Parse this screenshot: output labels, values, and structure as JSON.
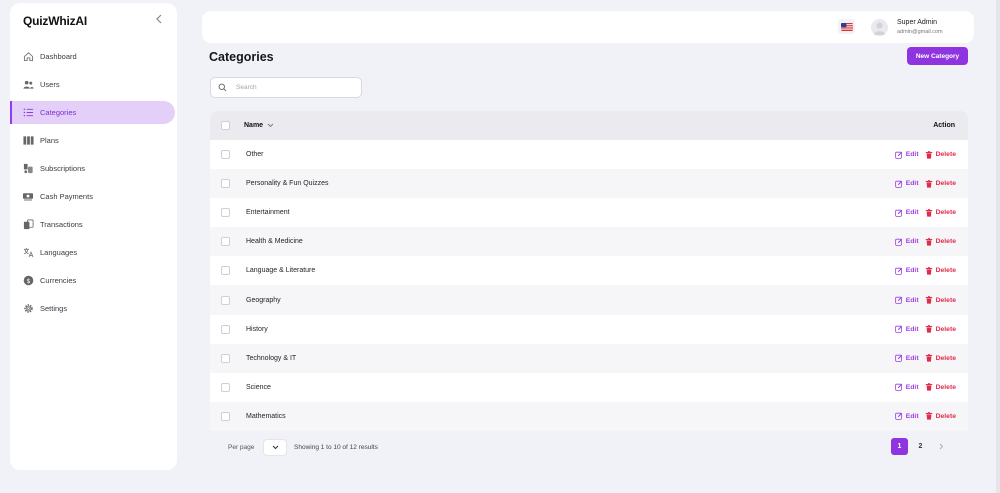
{
  "app": {
    "name": "QuizWhizAI"
  },
  "sidebar": {
    "items": [
      {
        "label": "Dashboard",
        "icon": "home-icon"
      },
      {
        "label": "Users",
        "icon": "users-icon"
      },
      {
        "label": "Categories",
        "icon": "list-icon",
        "active": true
      },
      {
        "label": "Plans",
        "icon": "columns-icon"
      },
      {
        "label": "Subscriptions",
        "icon": "subscriptions-icon"
      },
      {
        "label": "Cash Payments",
        "icon": "cash-icon"
      },
      {
        "label": "Transactions",
        "icon": "transactions-icon"
      },
      {
        "label": "Languages",
        "icon": "translate-icon"
      },
      {
        "label": "Currencies",
        "icon": "currency-icon"
      },
      {
        "label": "Settings",
        "icon": "gear-icon"
      }
    ]
  },
  "header": {
    "user_name": "Super Admin",
    "user_email": "admin@gmail.com",
    "language_flag": "us-flag-icon"
  },
  "page": {
    "title": "Categories",
    "new_button": "New Category",
    "search_placeholder": "Search"
  },
  "table": {
    "col_name": "Name",
    "col_action": "Action",
    "edit_label": "Edit",
    "delete_label": "Delete",
    "rows": [
      "Other",
      "Personality & Fun Quizzes",
      "Entertainment",
      "Health & Medicine",
      "Language & Literature",
      "Geography",
      "History",
      "Technology & IT",
      "Science",
      "Mathematics"
    ]
  },
  "footer": {
    "per_page_label": "Per page",
    "showing": "Showing 1 to 10 of 12 results",
    "pages": [
      "1",
      "2"
    ],
    "current_page": "1"
  },
  "colors": {
    "accent": "#8e35e0",
    "active_nav_bg": "#e4cff9",
    "delete": "#e02d4b",
    "edit": "#9b3ee0"
  }
}
